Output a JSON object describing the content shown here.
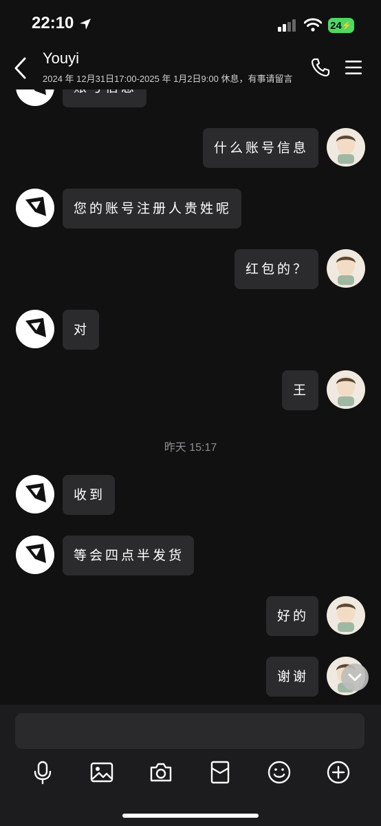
{
  "status": {
    "time": "22:10",
    "battery": "24"
  },
  "header": {
    "title": "Youyi",
    "subtitle": "2024 年 12月31日17:00-2025 年 1月2日9:00 休息，有事请留言"
  },
  "messages": [
    {
      "side": "left",
      "text": "账号信息"
    },
    {
      "side": "right",
      "text": "什么账号信息"
    },
    {
      "side": "left",
      "text": "您的账号注册人贵姓呢"
    },
    {
      "side": "right",
      "text": "红包的？"
    },
    {
      "side": "left",
      "text": "对"
    },
    {
      "side": "right",
      "text": "王"
    },
    {
      "side": "left",
      "text": "收到"
    },
    {
      "side": "left",
      "text": "等会四点半发货"
    },
    {
      "side": "right",
      "text": "好的"
    },
    {
      "side": "right",
      "text": "谢谢"
    }
  ],
  "timestamp": "昨天 15:17",
  "composer": {
    "placeholder": ""
  },
  "toolbar": [
    "microphone-icon",
    "image-icon",
    "camera-icon",
    "red-envelope-icon",
    "emoji-icon",
    "plus-icon"
  ],
  "colors": {
    "background": "#111112",
    "bubble": "#2b2b2e",
    "battery": "#4cd964"
  }
}
